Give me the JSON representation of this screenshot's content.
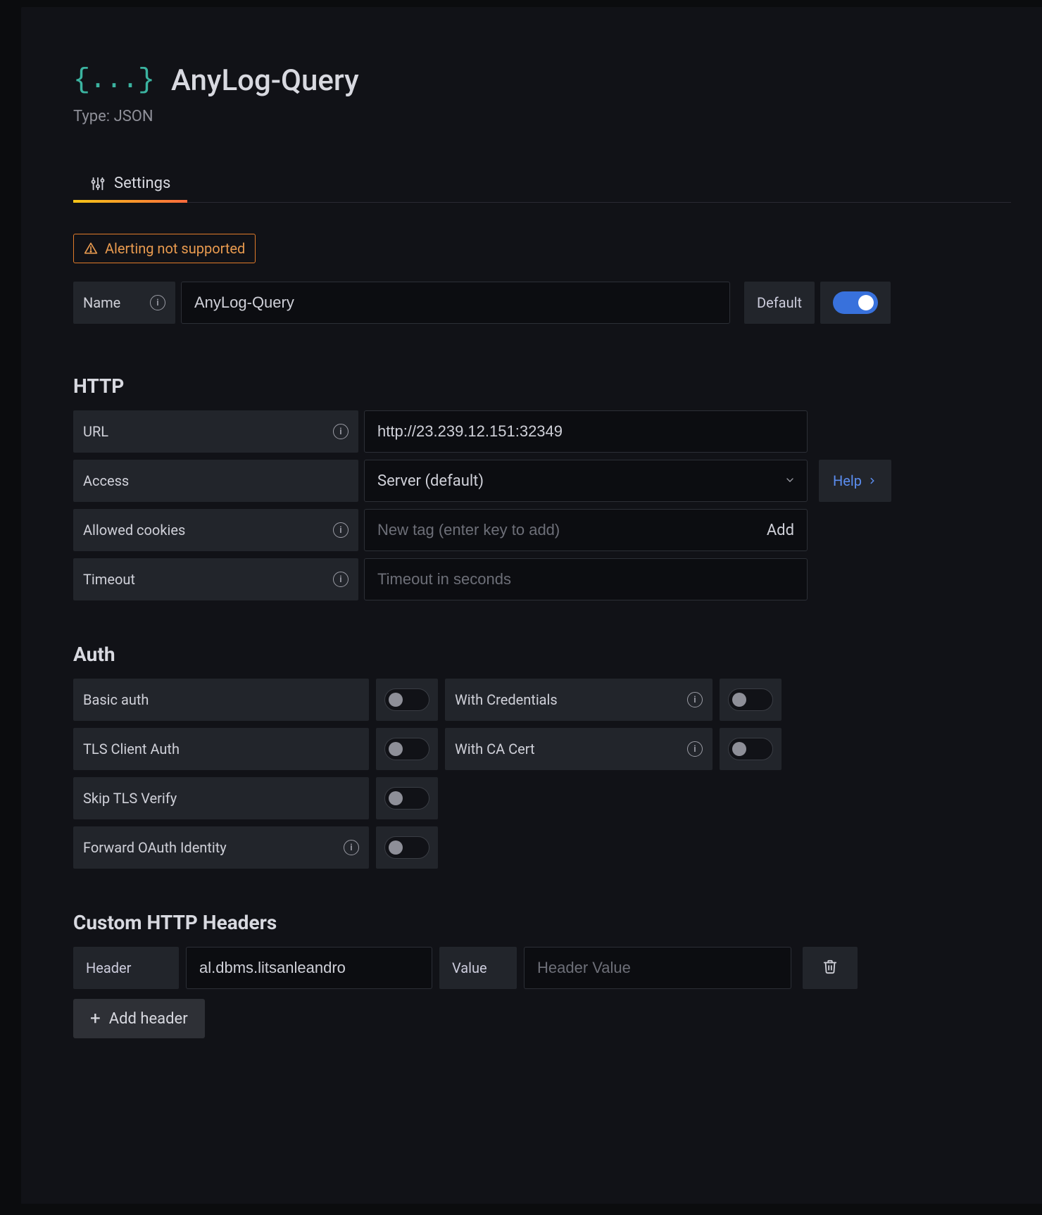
{
  "header": {
    "icon_glyph": "{...}",
    "title": "AnyLog-Query",
    "type_prefix": "Type: ",
    "type_value": "JSON"
  },
  "tabs": {
    "settings": "Settings"
  },
  "alert": {
    "text": "Alerting not supported"
  },
  "name_row": {
    "label": "Name",
    "value": "AnyLog-Query",
    "default_label": "Default",
    "default_on": true
  },
  "http": {
    "section": "HTTP",
    "url_label": "URL",
    "url_value": "http://23.239.12.151:32349",
    "access_label": "Access",
    "access_value": "Server (default)",
    "help": "Help",
    "cookies_label": "Allowed cookies",
    "cookies_placeholder": "New tag (enter key to add)",
    "cookies_add": "Add",
    "timeout_label": "Timeout",
    "timeout_placeholder": "Timeout in seconds"
  },
  "auth": {
    "section": "Auth",
    "basic": "Basic auth",
    "with_credentials": "With Credentials",
    "tls_client": "TLS Client Auth",
    "with_ca": "With CA Cert",
    "skip_tls": "Skip TLS Verify",
    "forward_oauth": "Forward OAuth Identity"
  },
  "headers": {
    "section": "Custom HTTP Headers",
    "header_label": "Header",
    "header_value": "al.dbms.litsanleandro",
    "value_label": "Value",
    "value_placeholder": "Header Value",
    "add_header": "Add header"
  }
}
